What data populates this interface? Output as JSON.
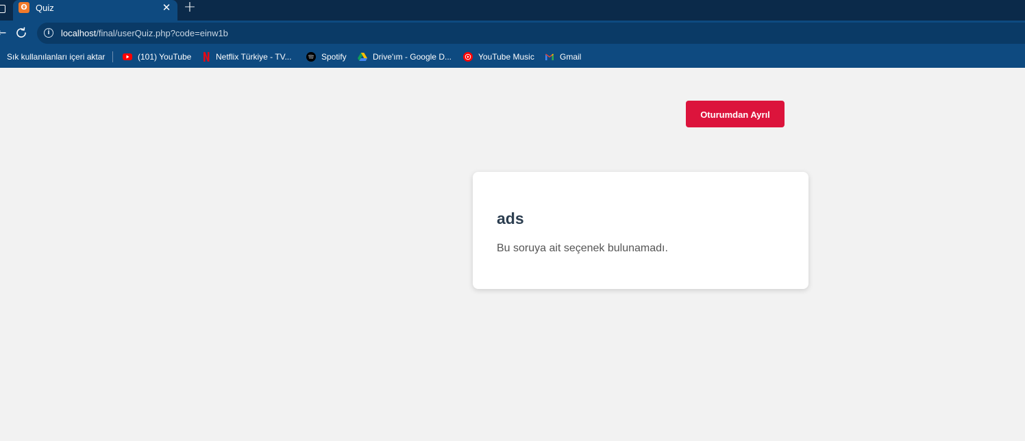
{
  "browser": {
    "tab": {
      "title": "Quiz",
      "favicon_glyph": "ʘ",
      "close_glyph": "✕"
    },
    "new_tab_glyph": "+",
    "address": {
      "host": "localhost",
      "path": "/final/userQuiz.php?code=einw1b"
    },
    "bookmarks": [
      {
        "label": "Sık kullanılanları içeri aktar",
        "icon": "import-icon"
      },
      {
        "label": "(101) YouTube",
        "icon": "youtube-icon"
      },
      {
        "label": "Netflix Türkiye - TV...",
        "icon": "netflix-icon"
      },
      {
        "label": "Spotify",
        "icon": "spotify-icon"
      },
      {
        "label": "Drive'ım - Google D...",
        "icon": "google-drive-icon"
      },
      {
        "label": "YouTube Music",
        "icon": "youtube-music-icon"
      },
      {
        "label": "Gmail",
        "icon": "gmail-icon"
      }
    ]
  },
  "page": {
    "logout_label": "Oturumdan Ayrıl",
    "question": {
      "title": "ads",
      "message": "Bu soruya ait seçenek bulunamadı."
    }
  },
  "colors": {
    "logout_button": "#dc143c",
    "title_text": "#2c3e50",
    "page_bg": "#f2f2f2",
    "chrome_bg": "#0e4a80"
  }
}
